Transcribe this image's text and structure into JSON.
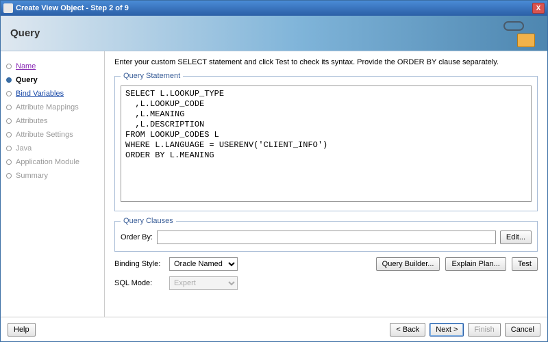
{
  "window": {
    "title": "Create View Object - Step 2 of 9",
    "close_label": "X"
  },
  "banner": {
    "page_title": "Query"
  },
  "nav": {
    "items": [
      {
        "label": "Name",
        "state": "visited"
      },
      {
        "label": "Query",
        "state": "current"
      },
      {
        "label": "Bind Variables",
        "state": "link"
      },
      {
        "label": "Attribute Mappings",
        "state": "future"
      },
      {
        "label": "Attributes",
        "state": "future"
      },
      {
        "label": "Attribute Settings",
        "state": "future"
      },
      {
        "label": "Java",
        "state": "future"
      },
      {
        "label": "Application Module",
        "state": "future"
      },
      {
        "label": "Summary",
        "state": "future"
      }
    ]
  },
  "main": {
    "instructions": "Enter your custom SELECT statement and click Test to check its syntax.  Provide the ORDER BY clause separately.",
    "statement_legend": "Query Statement",
    "statement_text": "SELECT L.LOOKUP_TYPE\n  ,L.LOOKUP_CODE\n  ,L.MEANING\n  ,L.DESCRIPTION\nFROM LOOKUP_CODES L\nWHERE L.LANGUAGE = USERENV('CLIENT_INFO')\nORDER BY L.MEANING",
    "clauses_legend": "Query Clauses",
    "order_by_label": "Order By:",
    "order_by_value": "",
    "edit_label": "Edit...",
    "binding_style_label": "Binding Style:",
    "binding_style_value": "Oracle Named",
    "sql_mode_label": "SQL Mode:",
    "sql_mode_value": "Expert",
    "query_builder_label": "Query Builder...",
    "explain_plan_label": "Explain Plan...",
    "test_label": "Test"
  },
  "footer": {
    "help": "Help",
    "back": "< Back",
    "next": "Next >",
    "finish": "Finish",
    "cancel": "Cancel"
  }
}
